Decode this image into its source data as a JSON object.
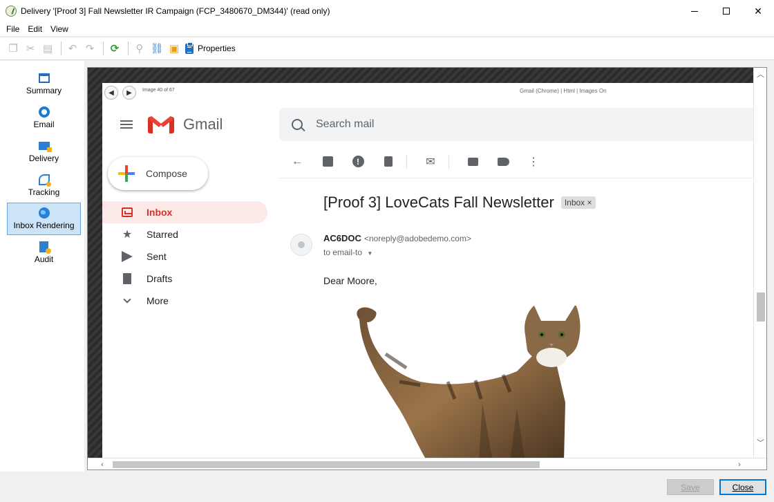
{
  "window": {
    "title": "Delivery '[Proof 3] Fall Newsletter IR Campaign (FCP_3480670_DM344)' (read only)"
  },
  "menu": [
    "File",
    "Edit",
    "View"
  ],
  "toolbar": {
    "properties_label": "Properties"
  },
  "nav": [
    {
      "label": "Summary",
      "icon": "summary-icon"
    },
    {
      "label": "Email",
      "icon": "email-icon"
    },
    {
      "label": "Delivery",
      "icon": "delivery-icon"
    },
    {
      "label": "Tracking",
      "icon": "tracking-icon"
    },
    {
      "label": "Inbox Rendering",
      "icon": "globe-icon",
      "active": true
    },
    {
      "label": "Audit",
      "icon": "audit-icon"
    }
  ],
  "render": {
    "image_counter": "Image 40 of 67",
    "client_info": "Gmail (Chrome) | Html | Images On"
  },
  "gmail": {
    "wordmark": "Gmail",
    "search_placeholder": "Search mail",
    "compose_label": "Compose",
    "nav": [
      {
        "label": "Inbox",
        "active": true
      },
      {
        "label": "Starred"
      },
      {
        "label": "Sent"
      },
      {
        "label": "Drafts"
      },
      {
        "label": "More"
      }
    ],
    "subject": "[Proof 3] LoveCats Fall Newsletter",
    "label_chip": "Inbox",
    "label_chip_close": "×",
    "sender_name": "AC6DOC",
    "sender_email": "<noreply@adobedemo.com>",
    "recipient": "to email-to",
    "greeting": "Dear Moore,"
  },
  "footer": {
    "save_label": "Save",
    "close_label": "Close"
  },
  "colors": {
    "accent": "#0078d7",
    "gmail_red": "#d93025",
    "active_nav_bg": "#cce4f7"
  }
}
